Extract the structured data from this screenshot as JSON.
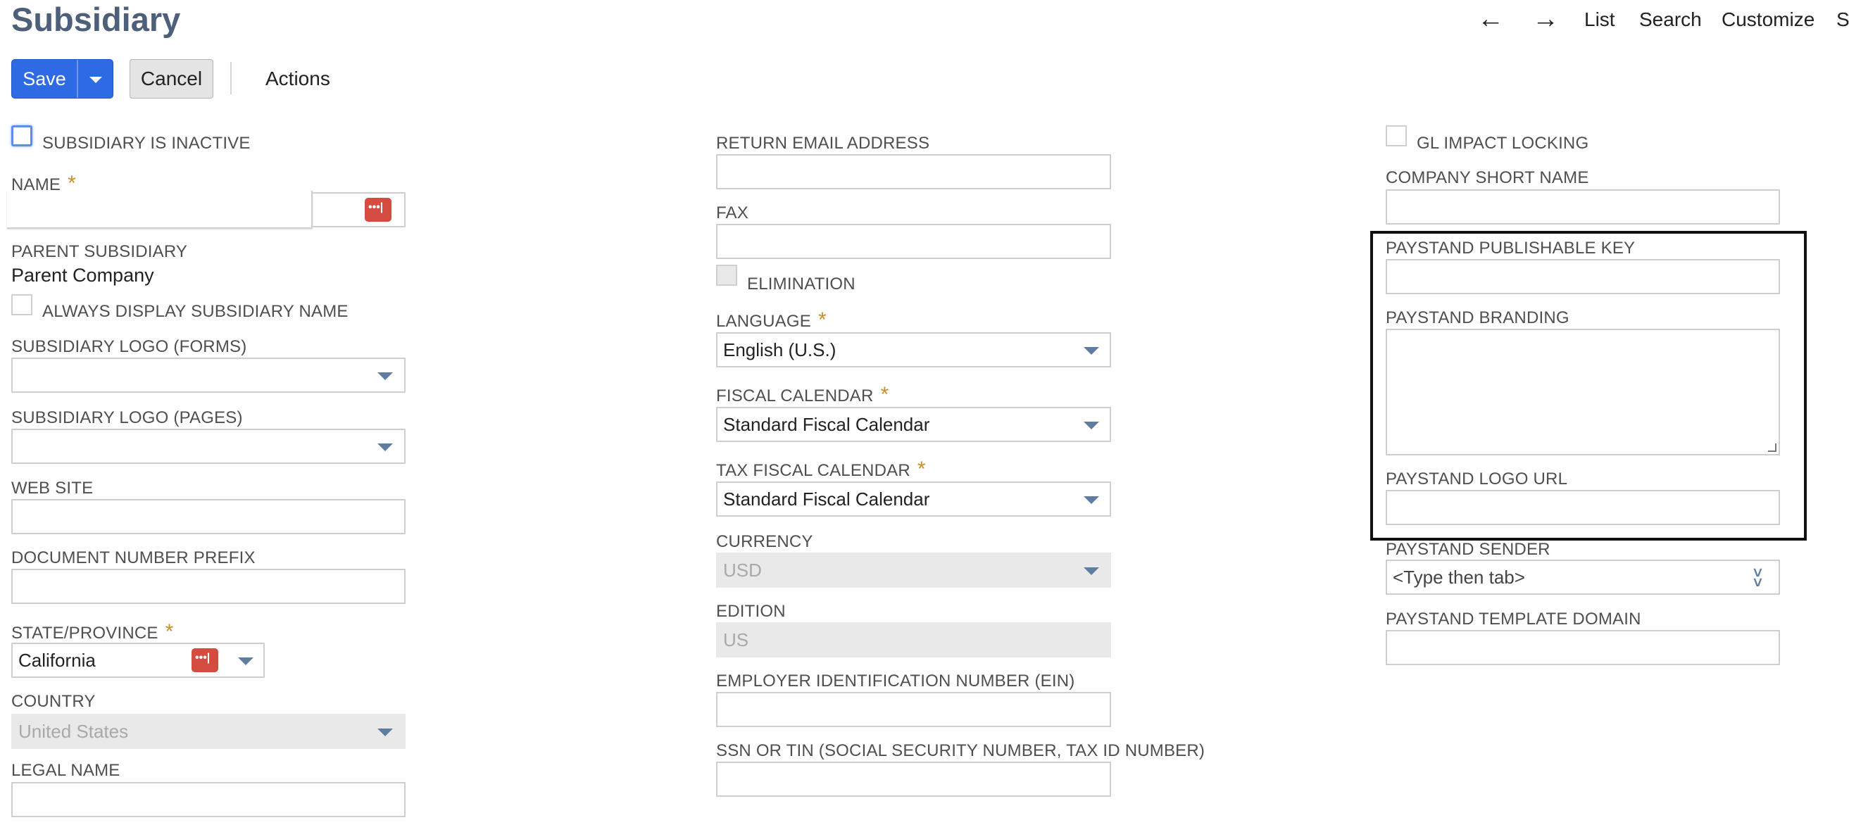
{
  "page_title": "Subsidiary",
  "top_nav": {
    "back_icon": "arrow-left-icon",
    "forward_icon": "arrow-right-icon",
    "list": "List",
    "search": "Search",
    "customize": "Customize",
    "more": "Sı"
  },
  "toolbar": {
    "save": "Save",
    "cancel": "Cancel",
    "actions": "Actions"
  },
  "col1": {
    "inactive_label": "SUBSIDIARY IS INACTIVE",
    "name_label": "NAME",
    "name_value": "",
    "parent_label": "PARENT SUBSIDIARY",
    "parent_value": "Parent Company",
    "always_display_label": "ALWAYS DISPLAY SUBSIDIARY NAME",
    "logo_forms_label": "SUBSIDIARY LOGO (FORMS)",
    "logo_pages_label": "SUBSIDIARY LOGO (PAGES)",
    "website_label": "WEB SITE",
    "doc_prefix_label": "DOCUMENT NUMBER PREFIX",
    "state_label": "STATE/PROVINCE",
    "state_value": "California",
    "country_label": "COUNTRY",
    "country_value": "United States",
    "legal_name_label": "LEGAL NAME"
  },
  "col2": {
    "return_email_label": "RETURN EMAIL ADDRESS",
    "fax_label": "FAX",
    "elimination_label": "ELIMINATION",
    "language_label": "LANGUAGE",
    "language_value": "English (U.S.)",
    "fiscal_cal_label": "FISCAL CALENDAR",
    "fiscal_cal_value": "Standard Fiscal Calendar",
    "tax_fiscal_cal_label": "TAX FISCAL CALENDAR",
    "tax_fiscal_cal_value": "Standard Fiscal Calendar",
    "currency_label": "CURRENCY",
    "currency_value": "USD",
    "edition_label": "EDITION",
    "edition_value": "US",
    "ein_label": "EMPLOYER IDENTIFICATION NUMBER (EIN)",
    "ssn_label": "SSN OR TIN (SOCIAL SECURITY NUMBER, TAX ID NUMBER)"
  },
  "col3": {
    "gl_locking_label": "GL IMPACT LOCKING",
    "short_name_label": "COMPANY SHORT NAME",
    "publishable_key_label": "PAYSTAND PUBLISHABLE KEY",
    "branding_label": "PAYSTAND BRANDING",
    "logo_url_label": "PAYSTAND LOGO URL",
    "sender_label": "PAYSTAND SENDER",
    "sender_placeholder": "<Type then tab>",
    "template_domain_label": "PAYSTAND TEMPLATE DOMAIN"
  },
  "required_marker": "*"
}
